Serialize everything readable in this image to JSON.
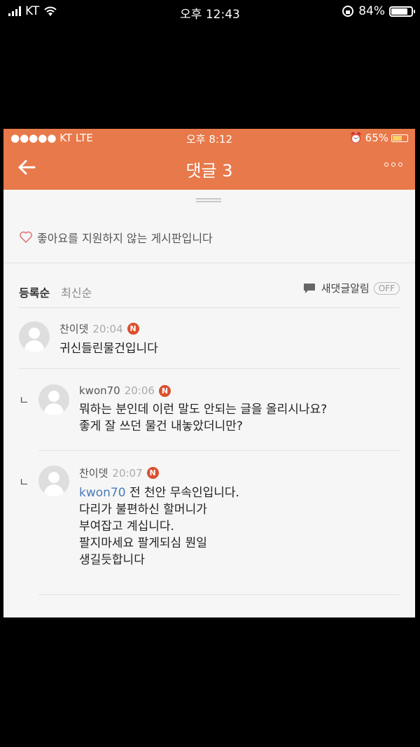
{
  "outer_status": {
    "carrier": "KT",
    "time": "오후 12:43",
    "battery": "84%",
    "battery_level": 0.84
  },
  "inner_status": {
    "carrier": "●●●●● KT  LTE",
    "time": "오후 8:12",
    "battery": "65%",
    "battery_level": 0.65
  },
  "header": {
    "title": "댓글 3"
  },
  "notice": "좋아요를 지원하지 않는 게시판입니다",
  "sort": {
    "by_register": "등록순",
    "by_latest": "최신순"
  },
  "alert": {
    "label": "새댓글알림",
    "toggle": "OFF"
  },
  "comments": [
    {
      "author": "찬이뎃",
      "time": "20:04",
      "badge": "N",
      "lines": [
        "귀신들린물건입니다"
      ]
    },
    {
      "reply_mark": "ㄴ",
      "author": "kwon70",
      "time": "20:06",
      "badge": "N",
      "lines": [
        "뭐하는 분인데 이런 말도 안되는 글을 올리시나요?",
        "좋게 잘 쓰던 물건 내놓았더니만?"
      ]
    },
    {
      "reply_mark": "ㄴ",
      "author": "찬이뎃",
      "time": "20:07",
      "badge": "N",
      "mention": "kwon70",
      "lines": [
        " 전 천안 무속인입니다.",
        "다리가 불편하신 할머니가",
        "부여잡고 계십니다.",
        "팔지마세요 팔게되심 뭔일",
        "생길듯합니다"
      ]
    }
  ]
}
